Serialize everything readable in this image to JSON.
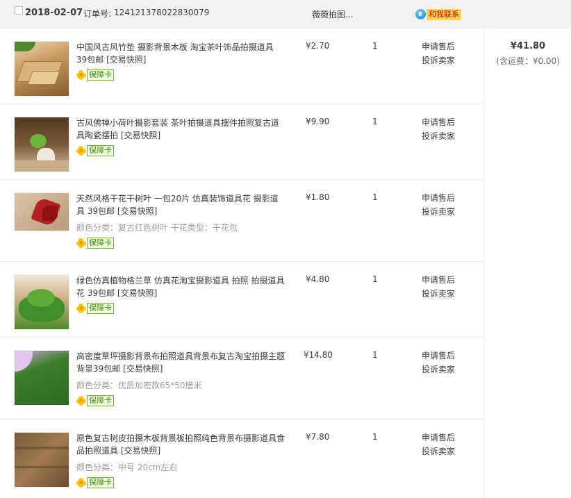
{
  "order": {
    "date": "2018-02-07",
    "order_label": "订单号:",
    "order_number": "124121378022830079",
    "shop_name": "薇薇拍图...",
    "contact_label": "和我联系"
  },
  "summary": {
    "total": "¥41.80",
    "shipping": "(含运费：¥0.00)"
  },
  "items": [
    {
      "title": "中国风古风竹垫 摄影背景木板 淘宝茶叶饰品拍摄道具 39包邮",
      "snapshot": "[交易快照]",
      "spec": "",
      "badge": "保障卡",
      "price": "¥2.70",
      "qty": "1",
      "op1": "申请售后",
      "op2": "投诉卖家"
    },
    {
      "title": "古风佛禅小荷叶摄影套装 茶叶拍摄道具摆件拍照复古道具陶瓷摆拍",
      "snapshot": "[交易快照]",
      "spec": "",
      "badge": "保障卡",
      "price": "¥9.90",
      "qty": "1",
      "op1": "申请售后",
      "op2": "投诉卖家"
    },
    {
      "title": "天然风格干花干树叶 一包20片 仿真装饰道具花 摄影道具 39包邮",
      "snapshot": "[交易快照]",
      "spec": "颜色分类：复古红色树叶   干花类型：干花包",
      "badge": "保障卡",
      "price": "¥1.80",
      "qty": "1",
      "op1": "申请售后",
      "op2": "投诉卖家"
    },
    {
      "title": "绿色仿真植物格兰草 仿真花淘宝摄影道具 拍照 拍摄道具花 39包邮",
      "snapshot": "[交易快照]",
      "spec": "",
      "badge": "保障卡",
      "price": "¥4.80",
      "qty": "1",
      "op1": "申请售后",
      "op2": "投诉卖家"
    },
    {
      "title": "高密度草坪摄影背景布拍照道具背景布复古淘宝拍摄主题背景39包邮",
      "snapshot": "[交易快照]",
      "spec": "颜色分类：优质加密款65*50厘米",
      "badge": "保障卡",
      "price": "¥14.80",
      "qty": "1",
      "op1": "申请售后",
      "op2": "投诉卖家"
    },
    {
      "title": "原色复古树皮拍摄木板背景板拍照纯色背景布摄影道具食品拍照道具",
      "snapshot": "[交易快照]",
      "spec": "颜色分类：中号 20cm左右",
      "badge": "保障卡",
      "price": "¥7.80",
      "qty": "1",
      "op1": "申请售后",
      "op2": "投诉卖家"
    }
  ],
  "icons": {
    "checkbox": "checkbox-icon",
    "contact": "wangwang-chat-icon",
    "badge": "guarantee-flower-icon"
  },
  "colors": {
    "badge_border": "#6fba2c",
    "contact_bg": "#ffd24d",
    "contact_text": "#cc0000"
  }
}
